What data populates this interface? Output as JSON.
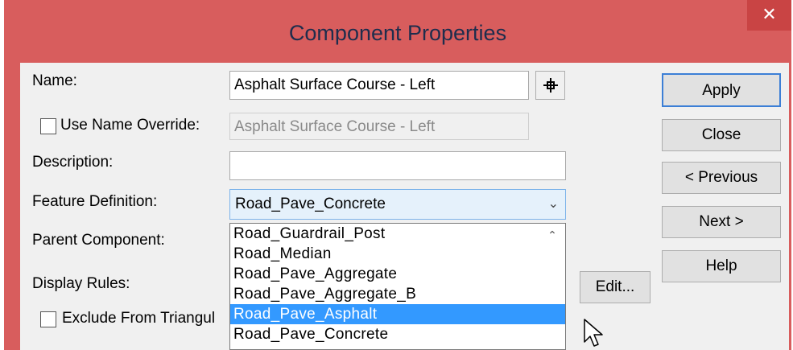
{
  "window": {
    "title": "Component Properties",
    "close_glyph": "✕"
  },
  "form": {
    "name_label": "Name:",
    "name_value": "Asphalt Surface Course - Left",
    "use_name_override_label": "Use Name Override:",
    "name_override_value": "Asphalt Surface Course - Left",
    "description_label": "Description:",
    "description_value": "",
    "feature_definition_label": "Feature Definition:",
    "feature_definition_value": "Road_Pave_Concrete",
    "parent_component_label": "Parent Component:",
    "display_rules_label": "Display Rules:",
    "exclude_label": "Exclude From Triangul",
    "edit_label": "Edit..."
  },
  "buttons": {
    "apply": "Apply",
    "close": "Close",
    "previous": "< Previous",
    "next": "Next >",
    "help": "Help"
  },
  "dropdown": {
    "items": [
      "Road_Guardrail_Post",
      "Road_Median",
      "Road_Pave_Aggregate",
      "Road_Pave_Aggregate_B",
      "Road_Pave_Asphalt",
      "Road_Pave_Concrete"
    ],
    "highlighted": "Road_Pave_Asphalt"
  },
  "icons": {
    "pick": "crosshair-icon",
    "combo_arrow": "chevron-down-icon",
    "scroll_up": "chevron-up-icon",
    "cursor": "mouse-pointer-icon"
  },
  "colors": {
    "titlebar": "#d85d5d",
    "close": "#c94444",
    "highlight": "#3399ff",
    "default_button_border": "#3c7fd6"
  }
}
